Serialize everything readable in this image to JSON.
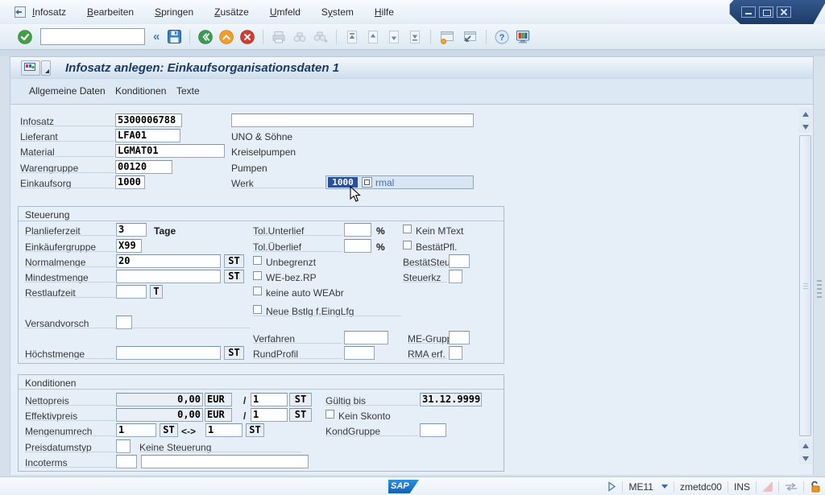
{
  "menubar": {
    "items": [
      {
        "label": "Infosatz"
      },
      {
        "label": "Bearbeiten"
      },
      {
        "label": "Springen"
      },
      {
        "label": "Zusätze"
      },
      {
        "label": "Umfeld"
      },
      {
        "label": "System"
      },
      {
        "label": "Hilfe"
      }
    ]
  },
  "toolbar": {
    "command_value": "",
    "collapse_glyph": "«"
  },
  "titlebar": {
    "title": "Infosatz anlegen: Einkaufsorganisationsdaten 1"
  },
  "app_toolbar": {
    "buttons": [
      {
        "label": "Allgemeine Daten"
      },
      {
        "label": "Konditionen"
      },
      {
        "label": "Texte"
      }
    ]
  },
  "header": {
    "rows": [
      {
        "label": "Infosatz",
        "value": "5300006788",
        "desc": ""
      },
      {
        "label": "Lieferant",
        "value": "LFA01",
        "desc": "UNO & Söhne"
      },
      {
        "label": "Material",
        "value": "LGMAT01",
        "desc": "Kreiselpumpen"
      },
      {
        "label": "Warengruppe",
        "value": "00120",
        "desc": "Pumpen"
      },
      {
        "label": "Einkaufsorg",
        "value": "1000",
        "desc": ""
      }
    ],
    "top_right_value": "",
    "werk": {
      "label": "Werk",
      "selected_value": "1000",
      "suffix_text": "rmal"
    }
  },
  "steuerung": {
    "title": "Steuerung",
    "planlieferzeit": {
      "label": "Planlieferzeit",
      "value": "3",
      "unit": "Tage"
    },
    "einkaeufergruppe": {
      "label": "Einkäufergruppe",
      "value": "X99"
    },
    "normalmenge": {
      "label": "Normalmenge",
      "value": "20",
      "unit": "ST"
    },
    "mindestmenge": {
      "label": "Mindestmenge",
      "value": "",
      "unit": "ST"
    },
    "restlaufzeit": {
      "label": "Restlaufzeit",
      "value": "",
      "unit": "T"
    },
    "versandvorsch": {
      "label": "Versandvorsch",
      "value": ""
    },
    "hoechstmenge": {
      "label": "Höchstmenge",
      "value": "",
      "unit": "ST"
    },
    "tol_unterlief": {
      "label": "Tol.Unterlief",
      "value": "",
      "unit": "%"
    },
    "tol_ueberlief": {
      "label": "Tol.Überlief",
      "value": "",
      "unit": "%"
    },
    "cb_unbegrenzt": "Unbegrenzt",
    "cb_we_bez_rp": "WE-bez.RP",
    "cb_keine_auto_weabr": "keine auto WEAbr",
    "cb_neue_bstlg": "Neue Bstlg f.EingLfg",
    "cb_kein_mtext": "Kein MText",
    "cb_bestaetpfl": "BestätPfl.",
    "bestaetsteu": {
      "label": "BestätSteu",
      "value": ""
    },
    "steuerkz": {
      "label": "Steuerkz",
      "value": ""
    },
    "verfahren": {
      "label": "Verfahren",
      "value": ""
    },
    "rundprofil": {
      "label": "RundProfil",
      "value": ""
    },
    "me_gruppe": {
      "label": "ME-Gruppe",
      "value": ""
    },
    "rma_erf": {
      "label": "RMA erf.",
      "value": ""
    }
  },
  "konditionen": {
    "title": "Konditionen",
    "nettopreis": {
      "label": "Nettopreis",
      "amount": "0,00",
      "currency": "EUR",
      "slash": "/",
      "per": "1",
      "unit": "ST"
    },
    "effektivpreis": {
      "label": "Effektivpreis",
      "amount": "0,00",
      "currency": "EUR",
      "slash": "/",
      "per": "1",
      "unit": "ST"
    },
    "gueltig_bis": {
      "label": "Gültig bis",
      "value": "31.12.9999"
    },
    "cb_kein_skonto": "Kein Skonto",
    "mengenumrech": {
      "label": "Mengenumrech",
      "v1": "1",
      "u1": "ST",
      "arrow": "<->",
      "v2": "1",
      "u2": "ST"
    },
    "kondgruppe": {
      "label": "KondGruppe",
      "value": ""
    },
    "preisdatumstyp": {
      "label": "Preisdatumstyp",
      "value": "",
      "note": "Keine Steuerung"
    },
    "incoterms": {
      "label": "Incoterms",
      "value1": "",
      "value2": ""
    }
  },
  "statusbar": {
    "sap_logo": "SAP",
    "transaction": "ME11",
    "system": "zmetdc00",
    "mode": "INS"
  }
}
